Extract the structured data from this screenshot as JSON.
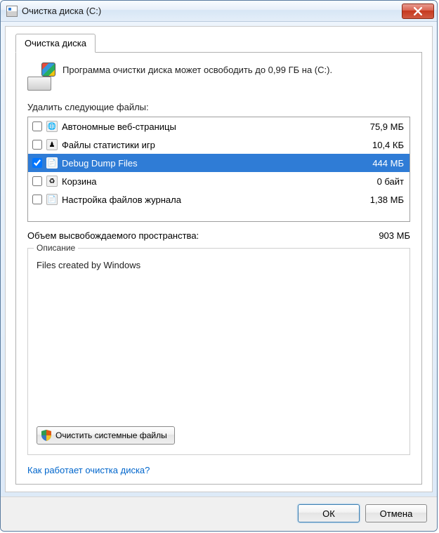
{
  "window": {
    "title": "Очистка диска  (C:)"
  },
  "tab": {
    "label": "Очистка диска"
  },
  "intro": "Программа очистки диска может освободить до 0,99 ГБ на (C:).",
  "list_label": "Удалить следующие файлы:",
  "files": [
    {
      "name": "Автономные веб-страницы",
      "size": "75,9 МБ",
      "checked": false,
      "selected": false,
      "icon": "globe-icon",
      "glyph": "🌐"
    },
    {
      "name": "Файлы статистики игр",
      "size": "10,4 КБ",
      "checked": false,
      "selected": false,
      "icon": "chess-icon",
      "glyph": "♟"
    },
    {
      "name": "Debug Dump Files",
      "size": "444 МБ",
      "checked": true,
      "selected": true,
      "icon": "file-icon",
      "glyph": "📄"
    },
    {
      "name": "Корзина",
      "size": "0 байт",
      "checked": false,
      "selected": false,
      "icon": "recycle-icon",
      "glyph": "♻"
    },
    {
      "name": "Настройка файлов журнала",
      "size": "1,38 МБ",
      "checked": false,
      "selected": false,
      "icon": "file-icon",
      "glyph": "📄"
    }
  ],
  "total": {
    "label": "Объем высвобождаемого пространства:",
    "value": "903 МБ"
  },
  "description": {
    "group_title": "Описание",
    "text": "Files created by Windows"
  },
  "clean_system_button": "Очистить системные файлы",
  "help_link": "Как работает очистка диска?",
  "buttons": {
    "ok": "ОК",
    "cancel": "Отмена"
  }
}
